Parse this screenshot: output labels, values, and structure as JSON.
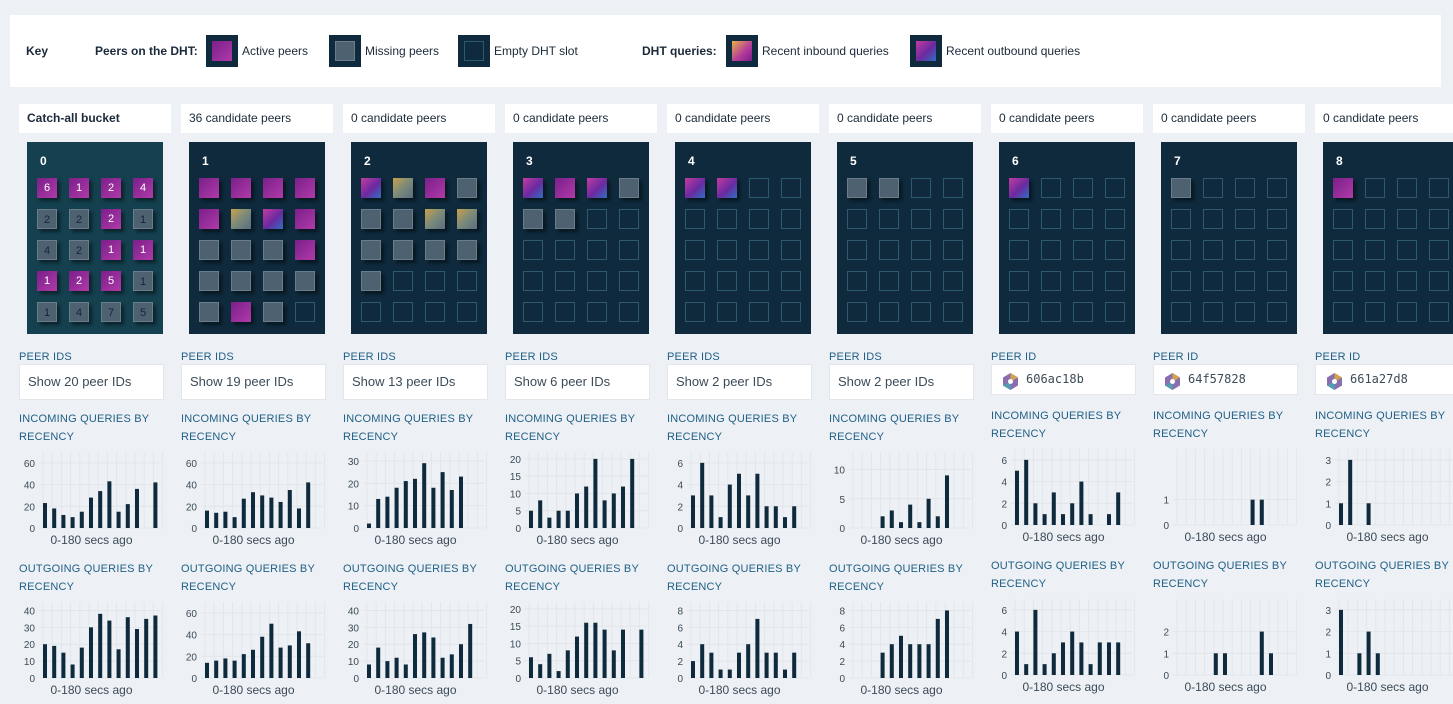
{
  "key": {
    "title": "Key",
    "peers_label": "Peers on the DHT:",
    "active": "Active peers",
    "missing": "Missing peers",
    "empty": "Empty DHT slot",
    "queries_label": "DHT queries:",
    "inbound": "Recent inbound queries",
    "outbound": "Recent outbound queries"
  },
  "peer_ids_label": "PEER IDS",
  "peer_id_label": "PEER ID",
  "incoming_label": "INCOMING QUERIES BY RECENCY",
  "outgoing_label": "OUTGOING QUERIES BY RECENCY",
  "x_caption": "0-180 secs ago",
  "colors": {
    "accent_text": "#1f5f86",
    "bucket_bg": "#0e2a3c",
    "bar": "#0e2a3c"
  },
  "buckets": [
    {
      "header": "Catch-all bucket",
      "number": "0",
      "peer_text": "Show 20 peer IDs",
      "slots": [
        [
          "a",
          "6"
        ],
        [
          "a",
          "1"
        ],
        [
          "a",
          "2"
        ],
        [
          "a",
          "4"
        ],
        [
          "m",
          "2"
        ],
        [
          "m",
          "2"
        ],
        [
          "a",
          "2"
        ],
        [
          "m",
          "1"
        ],
        [
          "m",
          "4"
        ],
        [
          "m",
          "2"
        ],
        [
          "a",
          "1"
        ],
        [
          "a",
          "1"
        ],
        [
          "a",
          "1"
        ],
        [
          "a",
          "2"
        ],
        [
          "a",
          "5"
        ],
        [
          "m",
          "1"
        ],
        [
          "m",
          "1"
        ],
        [
          "m",
          "4"
        ],
        [
          "m",
          "7"
        ],
        [
          "m",
          "5"
        ]
      ],
      "incoming": {
        "yticks": [
          0,
          20,
          40,
          60
        ],
        "ymax": 70,
        "values": [
          23,
          18,
          12,
          10,
          15,
          28,
          34,
          43,
          15,
          22,
          36,
          0,
          42
        ]
      },
      "outgoing": {
        "yticks": [
          0,
          10,
          20,
          30,
          40
        ],
        "ymax": 45,
        "values": [
          20,
          19,
          15,
          8,
          18,
          30,
          38,
          34,
          17,
          36,
          29,
          35,
          37
        ]
      }
    },
    {
      "header": "36 candidate peers",
      "number": "1",
      "peer_text": "Show 19 peer IDs",
      "slots": [
        [
          "a",
          ""
        ],
        [
          "a",
          ""
        ],
        [
          "a",
          ""
        ],
        [
          "a",
          ""
        ],
        [
          "a",
          ""
        ],
        [
          "g3",
          ""
        ],
        [
          "g2",
          ""
        ],
        [
          "a",
          ""
        ],
        [
          "m",
          ""
        ],
        [
          "m",
          ""
        ],
        [
          "m",
          ""
        ],
        [
          "a",
          ""
        ],
        [
          "m",
          ""
        ],
        [
          "m",
          ""
        ],
        [
          "m",
          ""
        ],
        [
          "m",
          ""
        ],
        [
          "m",
          ""
        ],
        [
          "a",
          ""
        ],
        [
          "m",
          ""
        ],
        [
          "e",
          ""
        ]
      ],
      "incoming": {
        "yticks": [
          0,
          20,
          40,
          60
        ],
        "ymax": 70,
        "values": [
          16,
          14,
          15,
          10,
          27,
          33,
          30,
          28,
          24,
          35,
          18,
          42,
          0
        ]
      },
      "outgoing": {
        "yticks": [
          0,
          20,
          40,
          60
        ],
        "ymax": 70,
        "values": [
          14,
          16,
          18,
          16,
          22,
          26,
          38,
          50,
          28,
          30,
          43,
          32,
          0
        ]
      }
    },
    {
      "header": "0 candidate peers",
      "number": "2",
      "peer_text": "Show 13 peer IDs",
      "slots": [
        [
          "g2",
          ""
        ],
        [
          "g3",
          ""
        ],
        [
          "a",
          ""
        ],
        [
          "m",
          ""
        ],
        [
          "m",
          ""
        ],
        [
          "m",
          ""
        ],
        [
          "g3",
          ""
        ],
        [
          "g3",
          ""
        ],
        [
          "m",
          ""
        ],
        [
          "m",
          ""
        ],
        [
          "m",
          ""
        ],
        [
          "m",
          ""
        ],
        [
          "m",
          ""
        ],
        [
          "e",
          ""
        ],
        [
          "e",
          ""
        ],
        [
          "e",
          ""
        ],
        [
          "e",
          ""
        ],
        [
          "e",
          ""
        ],
        [
          "e",
          ""
        ],
        [
          "e",
          ""
        ]
      ],
      "incoming": {
        "yticks": [
          0,
          10,
          20,
          30
        ],
        "ymax": 34,
        "values": [
          2,
          13,
          14,
          18,
          21,
          22,
          29,
          18,
          25,
          17,
          23,
          0,
          0
        ]
      },
      "outgoing": {
        "yticks": [
          0,
          10,
          20,
          30,
          40
        ],
        "ymax": 45,
        "values": [
          8,
          18,
          10,
          12,
          8,
          26,
          27,
          24,
          12,
          14,
          20,
          32,
          0
        ]
      }
    },
    {
      "header": "0 candidate peers",
      "number": "3",
      "peer_text": "Show 6 peer IDs",
      "slots": [
        [
          "g2",
          ""
        ],
        [
          "a",
          ""
        ],
        [
          "g2",
          ""
        ],
        [
          "m",
          ""
        ],
        [
          "m",
          ""
        ],
        [
          "m",
          ""
        ],
        [
          "e",
          ""
        ],
        [
          "e",
          ""
        ],
        [
          "e",
          ""
        ],
        [
          "e",
          ""
        ],
        [
          "e",
          ""
        ],
        [
          "e",
          ""
        ],
        [
          "e",
          ""
        ],
        [
          "e",
          ""
        ],
        [
          "e",
          ""
        ],
        [
          "e",
          ""
        ],
        [
          "e",
          ""
        ],
        [
          "e",
          ""
        ],
        [
          "e",
          ""
        ],
        [
          "e",
          ""
        ]
      ],
      "incoming": {
        "yticks": [
          0,
          5,
          10,
          15,
          20
        ],
        "ymax": 22,
        "values": [
          5,
          8,
          3,
          5,
          5,
          10,
          12,
          20,
          8,
          10,
          12,
          20,
          0
        ]
      },
      "outgoing": {
        "yticks": [
          0,
          5,
          10,
          15,
          20
        ],
        "ymax": 22,
        "values": [
          6,
          4,
          7,
          2,
          8,
          12,
          16,
          16,
          14,
          8,
          14,
          0,
          14
        ]
      }
    },
    {
      "header": "0 candidate peers",
      "number": "4",
      "peer_text": "Show 2 peer IDs",
      "slots": [
        [
          "g2",
          ""
        ],
        [
          "g2",
          ""
        ],
        [
          "e",
          ""
        ],
        [
          "e",
          ""
        ],
        [
          "e",
          ""
        ],
        [
          "e",
          ""
        ],
        [
          "e",
          ""
        ],
        [
          "e",
          ""
        ],
        [
          "e",
          ""
        ],
        [
          "e",
          ""
        ],
        [
          "e",
          ""
        ],
        [
          "e",
          ""
        ],
        [
          "e",
          ""
        ],
        [
          "e",
          ""
        ],
        [
          "e",
          ""
        ],
        [
          "e",
          ""
        ],
        [
          "e",
          ""
        ],
        [
          "e",
          ""
        ],
        [
          "e",
          ""
        ],
        [
          "e",
          ""
        ]
      ],
      "incoming": {
        "yticks": [
          0,
          2,
          4,
          6
        ],
        "ymax": 7,
        "values": [
          3,
          6,
          3,
          1,
          4,
          5,
          3,
          5,
          2,
          2,
          1,
          2,
          0
        ]
      },
      "outgoing": {
        "yticks": [
          0,
          2,
          4,
          6,
          8
        ],
        "ymax": 9,
        "values": [
          2,
          4,
          3,
          1,
          1,
          3,
          4,
          7,
          3,
          3,
          1,
          3,
          0
        ]
      }
    },
    {
      "header": "0 candidate peers",
      "number": "5",
      "peer_text": "Show 2 peer IDs",
      "slots": [
        [
          "m",
          ""
        ],
        [
          "m",
          ""
        ],
        [
          "e",
          ""
        ],
        [
          "e",
          ""
        ],
        [
          "e",
          ""
        ],
        [
          "e",
          ""
        ],
        [
          "e",
          ""
        ],
        [
          "e",
          ""
        ],
        [
          "e",
          ""
        ],
        [
          "e",
          ""
        ],
        [
          "e",
          ""
        ],
        [
          "e",
          ""
        ],
        [
          "e",
          ""
        ],
        [
          "e",
          ""
        ],
        [
          "e",
          ""
        ],
        [
          "e",
          ""
        ],
        [
          "e",
          ""
        ],
        [
          "e",
          ""
        ],
        [
          "e",
          ""
        ],
        [
          "e",
          ""
        ]
      ],
      "incoming": {
        "yticks": [
          0,
          5,
          10
        ],
        "ymax": 13,
        "values": [
          0,
          0,
          0,
          2,
          3,
          1,
          4,
          1,
          5,
          2,
          9,
          0,
          0
        ]
      },
      "outgoing": {
        "yticks": [
          0,
          2,
          4,
          6,
          8
        ],
        "ymax": 9,
        "values": [
          0,
          0,
          0,
          3,
          4,
          5,
          4,
          4,
          4,
          7,
          8,
          0,
          0
        ]
      }
    },
    {
      "header": "0 candidate peers",
      "number": "6",
      "peer_text": "606ac18b",
      "single": true,
      "slots": [
        [
          "g2",
          ""
        ],
        [
          "e",
          ""
        ],
        [
          "e",
          ""
        ],
        [
          "e",
          ""
        ],
        [
          "e",
          ""
        ],
        [
          "e",
          ""
        ],
        [
          "e",
          ""
        ],
        [
          "e",
          ""
        ],
        [
          "e",
          ""
        ],
        [
          "e",
          ""
        ],
        [
          "e",
          ""
        ],
        [
          "e",
          ""
        ],
        [
          "e",
          ""
        ],
        [
          "e",
          ""
        ],
        [
          "e",
          ""
        ],
        [
          "e",
          ""
        ],
        [
          "e",
          ""
        ],
        [
          "e",
          ""
        ],
        [
          "e",
          ""
        ],
        [
          "e",
          ""
        ]
      ],
      "incoming": {
        "yticks": [
          0,
          2,
          4,
          6
        ],
        "ymax": 7,
        "values": [
          5,
          6,
          2,
          1,
          3,
          1,
          2,
          4,
          1,
          0,
          1,
          3,
          0
        ]
      },
      "outgoing": {
        "yticks": [
          0,
          2,
          4,
          6
        ],
        "ymax": 7,
        "values": [
          4,
          1,
          6,
          1,
          2,
          3,
          4,
          3,
          1,
          3,
          3,
          3,
          0
        ]
      }
    },
    {
      "header": "0 candidate peers",
      "number": "7",
      "peer_text": "64f57828",
      "single": true,
      "slots": [
        [
          "m",
          ""
        ],
        [
          "e",
          ""
        ],
        [
          "e",
          ""
        ],
        [
          "e",
          ""
        ],
        [
          "e",
          ""
        ],
        [
          "e",
          ""
        ],
        [
          "e",
          ""
        ],
        [
          "e",
          ""
        ],
        [
          "e",
          ""
        ],
        [
          "e",
          ""
        ],
        [
          "e",
          ""
        ],
        [
          "e",
          ""
        ],
        [
          "e",
          ""
        ],
        [
          "e",
          ""
        ],
        [
          "e",
          ""
        ],
        [
          "e",
          ""
        ],
        [
          "e",
          ""
        ],
        [
          "e",
          ""
        ],
        [
          "e",
          ""
        ],
        [
          "e",
          ""
        ]
      ],
      "incoming": {
        "yticks": [
          0,
          1
        ],
        "ymax": 3,
        "values": [
          0,
          0,
          0,
          0,
          0,
          0,
          0,
          0,
          1,
          1,
          0,
          0,
          0
        ]
      },
      "outgoing": {
        "yticks": [
          0,
          1,
          2
        ],
        "ymax": 3.5,
        "values": [
          0,
          0,
          0,
          0,
          1,
          1,
          0,
          0,
          0,
          2,
          1,
          0,
          0
        ]
      }
    },
    {
      "header": "0 candidate peers",
      "number": "8",
      "peer_text": "661a27d8",
      "single": true,
      "slots": [
        [
          "a",
          ""
        ],
        [
          "e",
          ""
        ],
        [
          "e",
          ""
        ],
        [
          "e",
          ""
        ],
        [
          "e",
          ""
        ],
        [
          "e",
          ""
        ],
        [
          "e",
          ""
        ],
        [
          "e",
          ""
        ],
        [
          "e",
          ""
        ],
        [
          "e",
          ""
        ],
        [
          "e",
          ""
        ],
        [
          "e",
          ""
        ],
        [
          "e",
          ""
        ],
        [
          "e",
          ""
        ],
        [
          "e",
          ""
        ],
        [
          "e",
          ""
        ],
        [
          "e",
          ""
        ],
        [
          "e",
          ""
        ],
        [
          "e",
          ""
        ],
        [
          "e",
          ""
        ]
      ],
      "incoming": {
        "yticks": [
          0,
          1,
          2,
          3
        ],
        "ymax": 3.5,
        "values": [
          1,
          3,
          0,
          1,
          0,
          0,
          0,
          0,
          0,
          0,
          0,
          0,
          0
        ]
      },
      "outgoing": {
        "yticks": [
          0,
          1,
          2,
          3
        ],
        "ymax": 3.5,
        "values": [
          3,
          0,
          1,
          2,
          1,
          0,
          0,
          0,
          0,
          0,
          0,
          0,
          0
        ]
      }
    }
  ]
}
